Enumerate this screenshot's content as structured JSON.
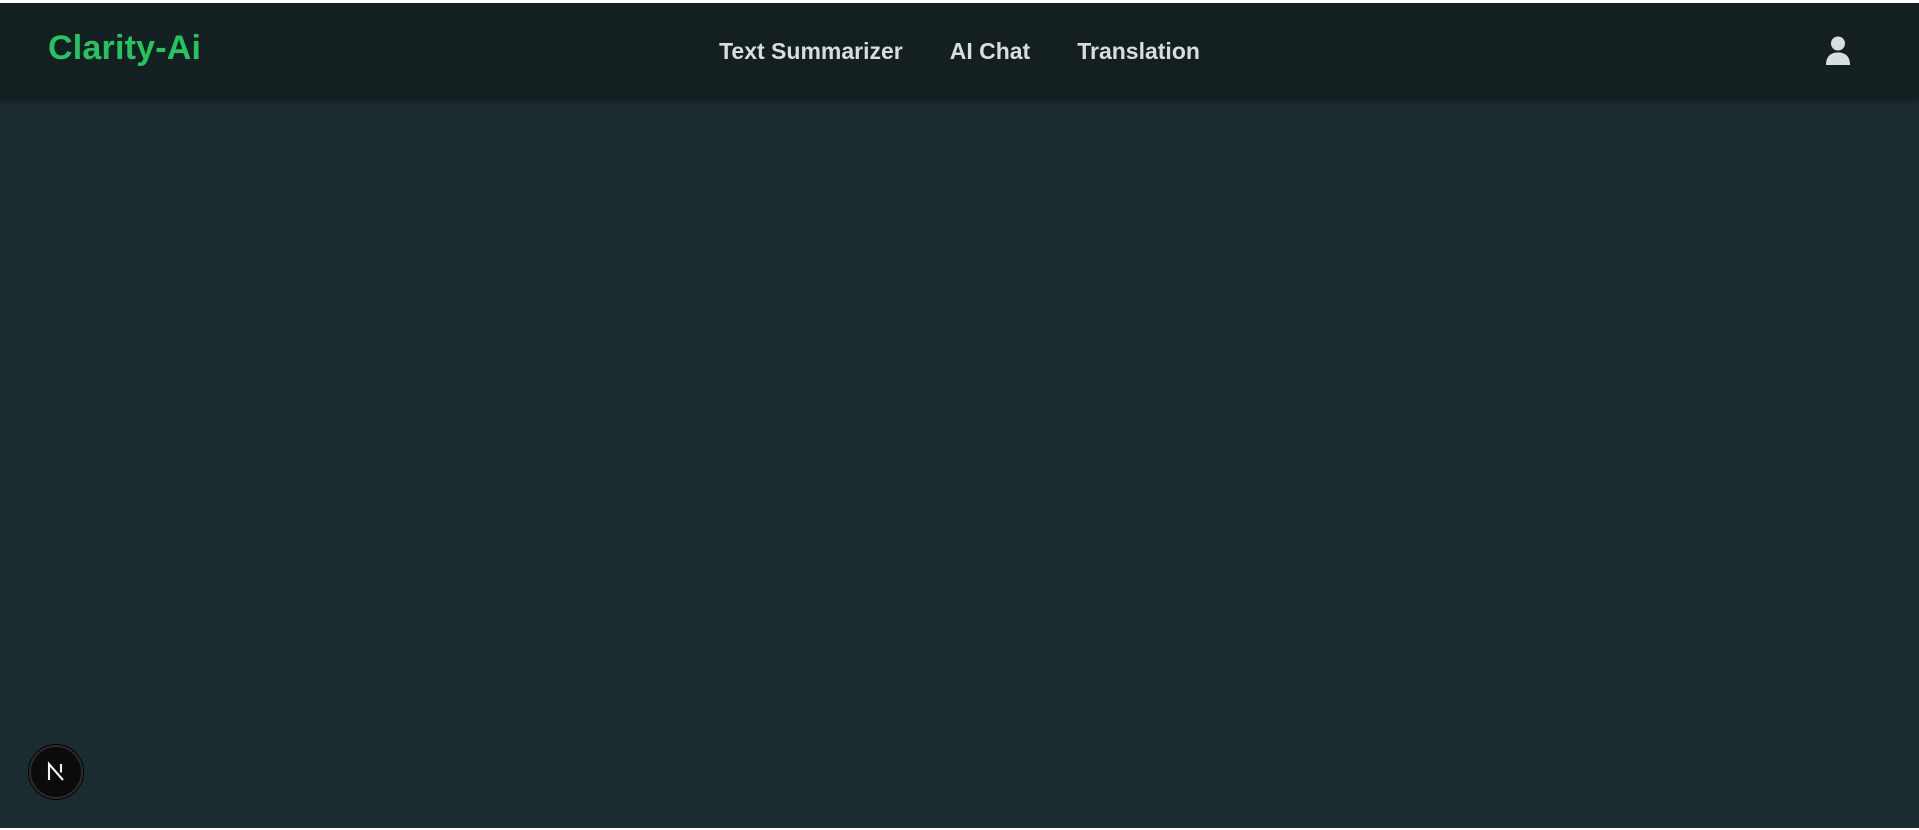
{
  "navbar": {
    "brand": "Clarity-Ai",
    "links": [
      {
        "label": "Text Summarizer"
      },
      {
        "label": "AI Chat"
      },
      {
        "label": "Translation"
      }
    ],
    "user_icon": "user-icon"
  },
  "dev_badge": {
    "icon": "nextjs-icon",
    "letter": "N"
  },
  "colors": {
    "page_background": "#1b2c31",
    "navbar_background": "#141f22",
    "brand_accent": "#22c55e",
    "nav_text": "#d8dde0"
  }
}
